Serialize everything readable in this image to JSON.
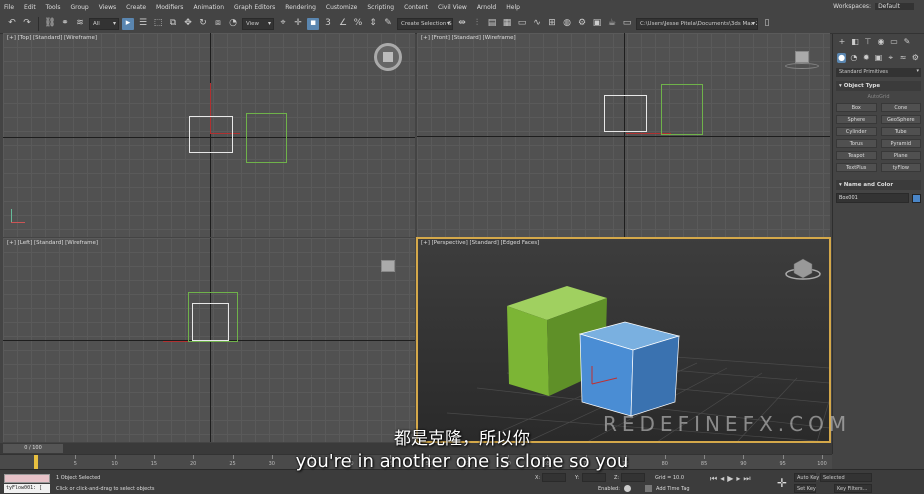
{
  "menu": [
    "File",
    "Edit",
    "Tools",
    "Group",
    "Views",
    "Create",
    "Modifiers",
    "Animation",
    "Graph Editors",
    "Rendering",
    "Customize",
    "Scripting",
    "Content",
    "Civil View",
    "Arnold",
    "Help"
  ],
  "workspaces": {
    "label": "Workspaces:",
    "value": "Default"
  },
  "toolbar": {
    "filter": "All",
    "view": "View",
    "selection_set": "Create Selection Se",
    "path": "C:\\Users\\Jesse Pitela\\Documents\\3ds Max 2022"
  },
  "viewports": {
    "top": "[+] [Top] [Standard] [Wireframe]",
    "front": "[+] [Front] [Standard] [Wireframe]",
    "left": "[+] [Left] [Standard] [Wireframe]",
    "perspective": "[+] [Perspective] [Standard] [Edged Faces]"
  },
  "command_panel": {
    "dropdown": "Standard Primitives",
    "object_type": "Object Type",
    "autogrid": "AutoGrid",
    "buttons": [
      "Box",
      "Cone",
      "Sphere",
      "GeoSphere",
      "Cylinder",
      "Tube",
      "Torus",
      "Pyramid",
      "Teapot",
      "Plane",
      "TextPlus",
      "tyFlow"
    ],
    "name_color": "Name and Color",
    "object_name": "Box001",
    "object_color": "#4a86c8"
  },
  "timeline": {
    "slider": "0 / 100",
    "ticks": [
      "0",
      "5",
      "10",
      "15",
      "20",
      "25",
      "30",
      "35",
      "40",
      "45",
      "50",
      "55",
      "60",
      "65",
      "70",
      "75",
      "80",
      "85",
      "90",
      "95",
      "100"
    ]
  },
  "status": {
    "script_text": "tyFlow001: [",
    "selected": "1 Object Selected",
    "hint": "Click or click-and-drag to select objects",
    "x": "X:",
    "y": "Y:",
    "z": "Z:",
    "grid": "Grid = 10.0",
    "enabled": "Enabled:",
    "add_time_tag": "Add Time Tag",
    "auto_key": "Auto Key",
    "selected_dd": "Selected",
    "set_key": "Set Key",
    "key_filters": "Key Filters..."
  },
  "subtitles": {
    "chinese": "都是克隆，所以你",
    "english": "you're in another one is clone so you"
  },
  "watermark": "REDEFINEFX.COM"
}
